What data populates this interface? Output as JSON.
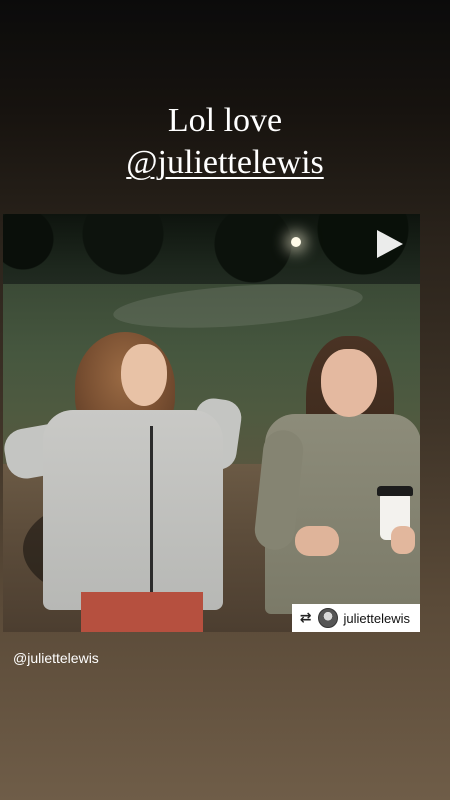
{
  "caption": {
    "line1": "Lol love",
    "line2": "@juliettelewis"
  },
  "video": {
    "play_icon": "play-icon"
  },
  "repost": {
    "icon": "repost-icon",
    "glyph": "⇄",
    "username": "juliettelewis"
  },
  "credit": {
    "text": "@juliettelewis"
  }
}
